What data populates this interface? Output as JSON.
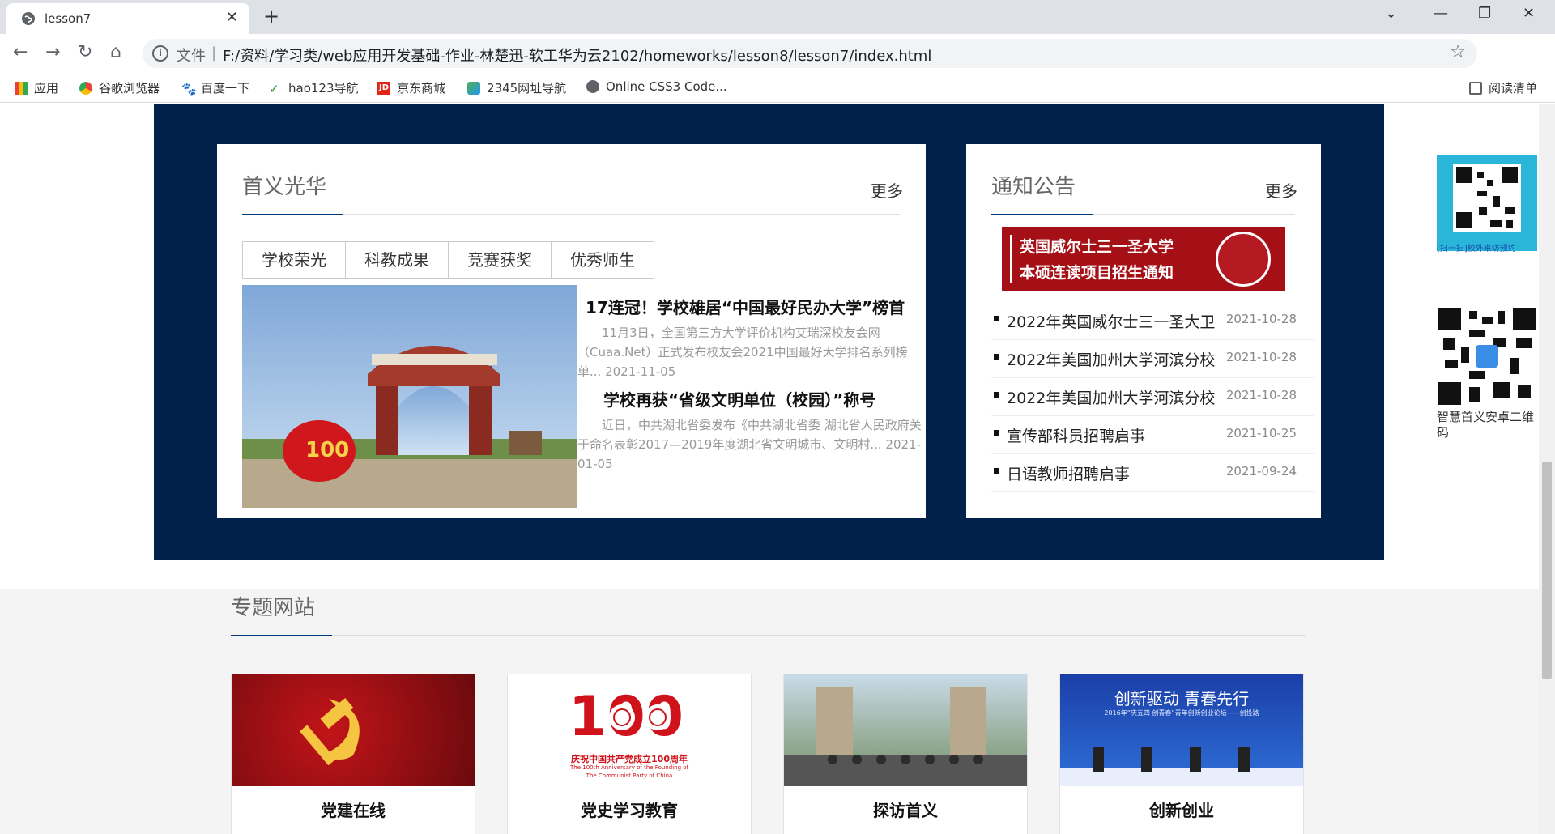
{
  "browser": {
    "tab_title": "lesson7",
    "new_tab": "+",
    "file_label": "文件",
    "url": "F:/资料/学习类/web应用开发基础-作业-林楚迅-软工华为云2102/homeworks/lesson8/lesson7/index.html",
    "bookmarks": [
      "应用",
      "谷歌浏览器",
      "百度一下",
      "hao123导航",
      "京东商城",
      "2345网址导航",
      "Online CSS3 Code..."
    ],
    "reading_list": "阅读清单"
  },
  "honors": {
    "title": "首义光华",
    "more": "更多",
    "tabs": [
      "学校荣光",
      "科教成果",
      "竞赛获奖",
      "优秀师生"
    ],
    "news": [
      {
        "title": "17连冠！学校雄居“中国最好民办大学”榜首",
        "summary": "11月3日，全国第三方大学评价机构艾瑞深校友会网（Cuaa.Net）正式发布校友会2021中国最好大学排名系列榜单... 2021-11-05"
      },
      {
        "title": "学校再获“省级文明单位（校园）”称号",
        "summary": "近日，中共湖北省委发布《中共湖北省委 湖北省人民政府关于命名表彰2017—2019年度湖北省文明城市、文明村... 2021-01-05"
      }
    ]
  },
  "notices": {
    "title": "通知公告",
    "more": "更多",
    "banner_line1": "英国威尔士三一圣大学",
    "banner_line2": "本硕连读项目招生通知",
    "items": [
      {
        "title": "2022年英国威尔士三一圣大卫",
        "date": "2021-10-28"
      },
      {
        "title": "2022年美国加州大学河滨分校",
        "date": "2021-10-28"
      },
      {
        "title": "2022年美国加州大学河滨分校",
        "date": "2021-10-28"
      },
      {
        "title": "宣传部科员招聘启事",
        "date": "2021-10-25"
      },
      {
        "title": "日语教师招聘启事",
        "date": "2021-09-24"
      }
    ]
  },
  "topics": {
    "title": "专题网站",
    "cards": [
      "党建在线",
      "党史学习教育",
      "探访首义",
      "创新创业"
    ],
    "party_banner_main": "庆祝中国共产党成立100周年",
    "party_banner_en1": "The 100th Anniversary of the Founding of",
    "party_banner_en2": "The Communist Party of China",
    "innovation_banner": "创新驱动 青春先行",
    "innovation_sub": "2016年“庆五四 创青春”青年创新创业论坛——创投路"
  },
  "sidebar": {
    "qr1_label": "[扫一扫]校外来访预约",
    "qr2_label": "智慧首义安卓二维码"
  },
  "colors": {
    "navy": "#00224a",
    "accent": "#003a7a",
    "banner_red": "#a50f16"
  }
}
